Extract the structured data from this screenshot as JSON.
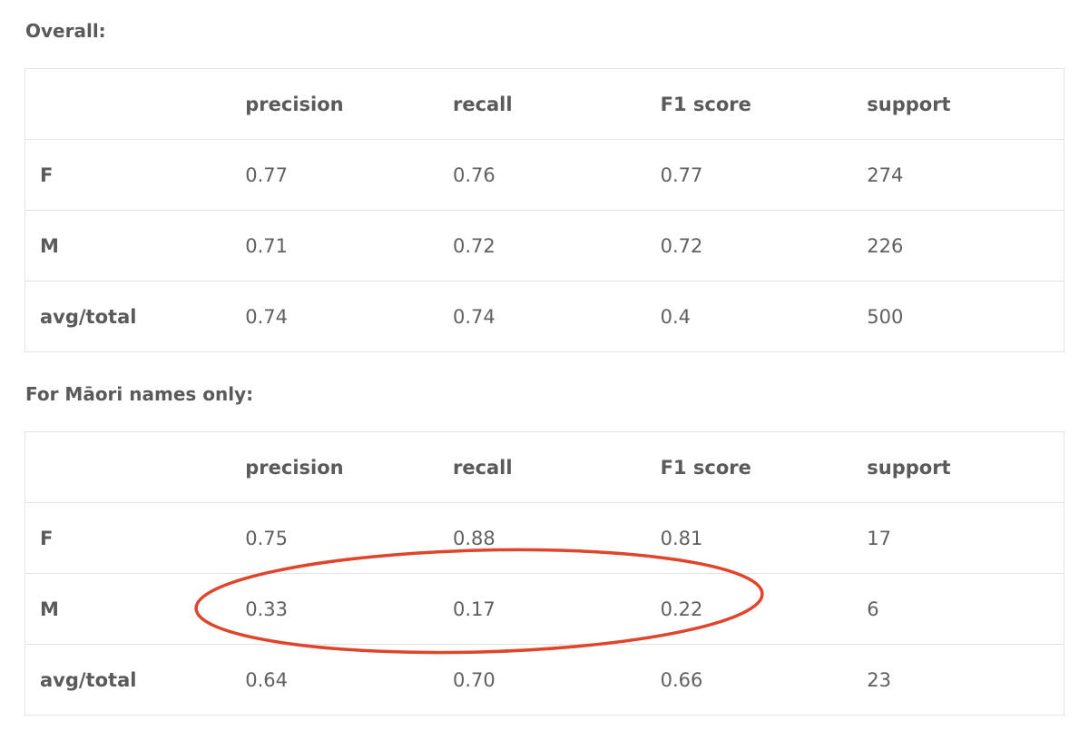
{
  "sections": [
    {
      "heading": "Overall:",
      "columns": [
        "",
        "precision",
        "recall",
        "F1 score",
        "support"
      ],
      "rows": [
        {
          "label": "F",
          "values": [
            "0.77",
            "0.76",
            "0.77",
            "274"
          ]
        },
        {
          "label": "M",
          "values": [
            "0.71",
            "0.72",
            "0.72",
            "226"
          ]
        },
        {
          "label": "avg/total",
          "values": [
            "0.74",
            "0.74",
            "0.4",
            "500"
          ]
        }
      ]
    },
    {
      "heading": "For Māori names only:",
      "columns": [
        "",
        "precision",
        "recall",
        "F1 score",
        "support"
      ],
      "rows": [
        {
          "label": "F",
          "values": [
            "0.75",
            "0.88",
            "0.81",
            "17"
          ]
        },
        {
          "label": "M",
          "values": [
            "0.33",
            "0.17",
            "0.22",
            "6"
          ]
        },
        {
          "label": "avg/total",
          "values": [
            "0.64",
            "0.70",
            "0.66",
            "23"
          ]
        }
      ]
    }
  ],
  "annotation": {
    "type": "ellipse",
    "color": "#e0442a",
    "target": "Māori names M row: precision, recall, F1 score"
  }
}
